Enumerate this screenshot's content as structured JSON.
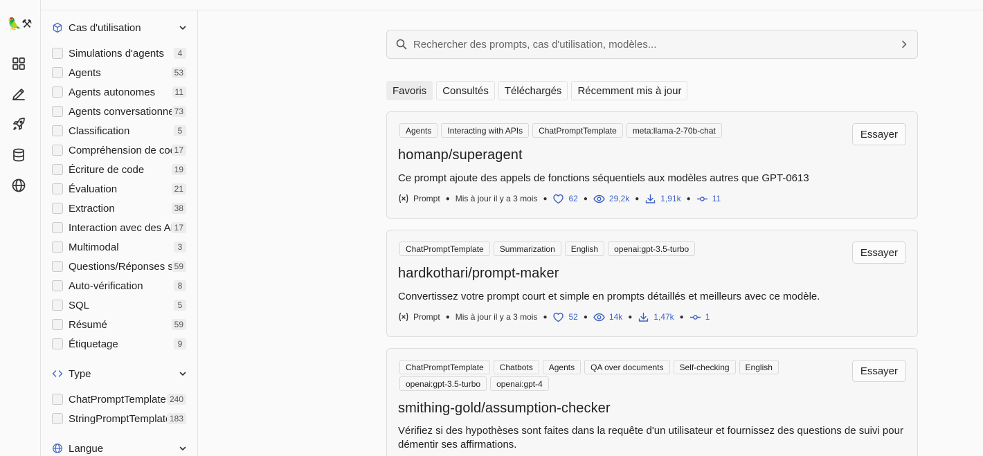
{
  "sidebar": {
    "use_cases": {
      "title": "Cas d'utilisation",
      "items": [
        {
          "label": "Simulations d'agents",
          "count": "4"
        },
        {
          "label": "Agents",
          "count": "53"
        },
        {
          "label": "Agents autonomes",
          "count": "11"
        },
        {
          "label": "Agents conversationnels",
          "count": "73"
        },
        {
          "label": "Classification",
          "count": "5"
        },
        {
          "label": "Compréhension de code",
          "count": "17"
        },
        {
          "label": "Écriture de code",
          "count": "19"
        },
        {
          "label": "Évaluation",
          "count": "21"
        },
        {
          "label": "Extraction",
          "count": "38"
        },
        {
          "label": "Interaction avec des APIs",
          "count": "17"
        },
        {
          "label": "Multimodal",
          "count": "3"
        },
        {
          "label": "Questions/Réponses sur documents",
          "count": "59"
        },
        {
          "label": "Auto-vérification",
          "count": "8"
        },
        {
          "label": "SQL",
          "count": "5"
        },
        {
          "label": "Résumé",
          "count": "59"
        },
        {
          "label": "Étiquetage",
          "count": "9"
        }
      ]
    },
    "type": {
      "title": "Type",
      "items": [
        {
          "label": "ChatPromptTemplate",
          "count": "240"
        },
        {
          "label": "StringPromptTemplate",
          "count": "183"
        }
      ]
    },
    "language": {
      "title": "Langue"
    }
  },
  "search": {
    "placeholder": "Rechercher des prompts, cas d'utilisation, modèles..."
  },
  "tabs": [
    {
      "label": "Favoris",
      "active": true
    },
    {
      "label": "Consultés",
      "active": false
    },
    {
      "label": "Téléchargés",
      "active": false
    },
    {
      "label": "Récemment mis à jour",
      "active": false
    }
  ],
  "cards": [
    {
      "tags": [
        "Agents",
        "Interacting with APIs",
        "ChatPromptTemplate",
        "meta:llama-2-70b-chat"
      ],
      "title": "homanp/superagent",
      "description": "Ce prompt ajoute des appels de fonctions séquentiels aux modèles autres que GPT-0613",
      "kind": "Prompt",
      "updated": "Mis à jour il y a 3 mois",
      "likes": "62",
      "views": "29,2k",
      "downloads": "1,91k",
      "forks": "11",
      "try_label": "Essayer"
    },
    {
      "tags": [
        "ChatPromptTemplate",
        "Summarization",
        "English",
        "openai:gpt-3.5-turbo"
      ],
      "title": "hardkothari/prompt-maker",
      "description": "Convertissez votre prompt court et simple en prompts détaillés et meilleurs avec ce modèle.",
      "kind": "Prompt",
      "updated": "Mis à jour il y a 3 mois",
      "likes": "52",
      "views": "14k",
      "downloads": "1,47k",
      "forks": "1",
      "try_label": "Essayer"
    },
    {
      "tags": [
        "ChatPromptTemplate",
        "Chatbots",
        "Agents",
        "QA over documents",
        "Self-checking",
        "English",
        "openai:gpt-3.5-turbo",
        "openai:gpt-4"
      ],
      "title": "smithing-gold/assumption-checker",
      "description": "Vérifiez si des hypothèses sont faites dans la requête d'un utilisateur et fournissez des questions de suivi pour démentir ses affirmations.",
      "try_label": "Essayer"
    }
  ],
  "icons": {
    "logo": "🦜⚒",
    "rail": [
      "grid-icon",
      "pencil-icon",
      "rocket-icon",
      "database-icon",
      "globe-icon"
    ]
  },
  "colors": {
    "accent": "#3c5fc4",
    "background": "#fafafa",
    "card": "#f7f7f7",
    "border": "#dedede"
  }
}
